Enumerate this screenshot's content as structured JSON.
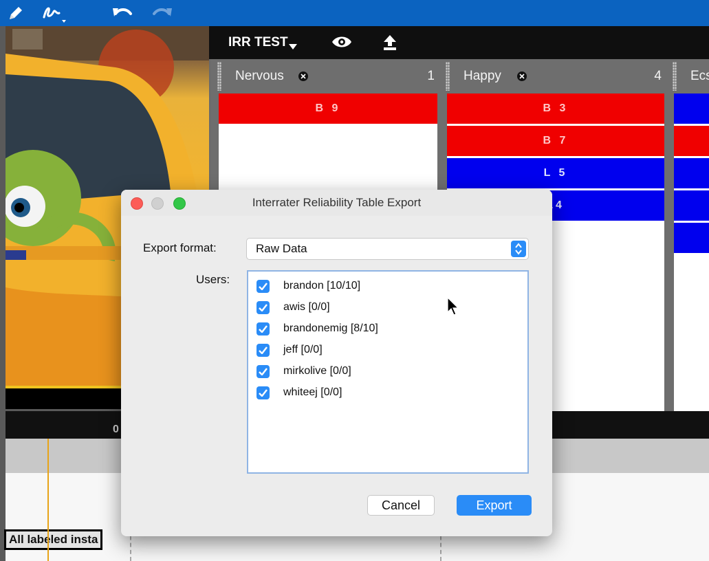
{
  "toolbar": {
    "icons": [
      "pencil-icon",
      "signature-icon",
      "undo-icon",
      "redo-icon"
    ]
  },
  "panel": {
    "title": "IRR TEST",
    "icons": [
      "eye-icon",
      "upload-icon"
    ]
  },
  "columns": [
    {
      "name": "Nervous",
      "count": "1",
      "cells": [
        {
          "label": "B 9",
          "color": "red"
        }
      ]
    },
    {
      "name": "Happy",
      "count": "4",
      "cells": [
        {
          "label": "B 3",
          "color": "red"
        },
        {
          "label": "B 7",
          "color": "red"
        },
        {
          "label": "L 5",
          "color": "blue"
        },
        {
          "label": "14",
          "color": "blue"
        }
      ]
    },
    {
      "name": "Ecs",
      "count": "",
      "cells": [
        {
          "label": "",
          "color": "blue"
        },
        {
          "label": "",
          "color": "red"
        },
        {
          "label": "",
          "color": "blue"
        },
        {
          "label": "",
          "color": "blue"
        },
        {
          "label": "",
          "color": "blue"
        }
      ]
    }
  ],
  "timeline": {
    "marker": "0",
    "track_label": "All labeled insta"
  },
  "dialog": {
    "title": "Interrater Reliability Table Export",
    "format_label": "Export format:",
    "format_value": "Raw Data",
    "users_label": "Users:",
    "users": [
      {
        "name": "brandon [10/10]",
        "checked": true
      },
      {
        "name": "awis [0/0]",
        "checked": true
      },
      {
        "name": "brandonemig [8/10]",
        "checked": true
      },
      {
        "name": "jeff [0/0]",
        "checked": true
      },
      {
        "name": "mirkolive [0/0]",
        "checked": true
      },
      {
        "name": "whiteej [0/0]",
        "checked": true
      }
    ],
    "cancel_label": "Cancel",
    "export_label": "Export"
  },
  "colors": {
    "toolbar": "#0b63c0",
    "red_code": "#f00000",
    "blue_code": "#0000ee",
    "accent": "#2a8cf7"
  }
}
